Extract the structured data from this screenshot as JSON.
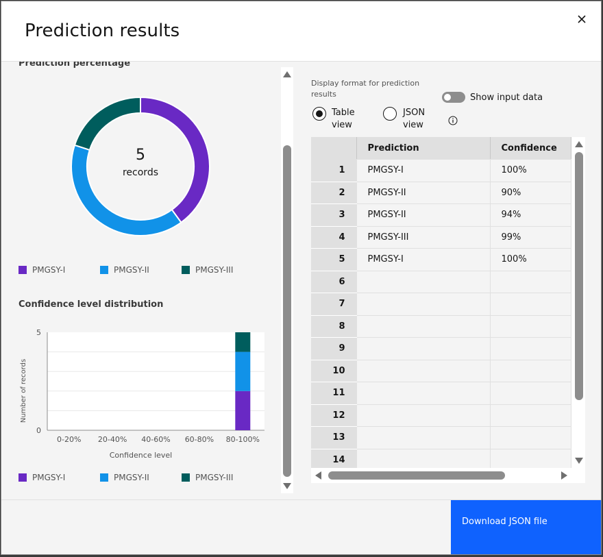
{
  "modal": {
    "title": "Prediction results",
    "close_icon": "close-icon"
  },
  "left": {
    "section_cut_heading": "Prediction percentage",
    "donut": {
      "count": "5",
      "label": "records",
      "slices": [
        {
          "name": "PMGSY-I",
          "value": 2,
          "color": "#6929c4"
        },
        {
          "name": "PMGSY-II",
          "value": 2,
          "color": "#1192e8"
        },
        {
          "name": "PMGSY-III",
          "value": 1,
          "color": "#005d5d"
        }
      ]
    },
    "legend": [
      {
        "label": "PMGSY-I",
        "color": "#6929c4"
      },
      {
        "label": "PMGSY-II",
        "color": "#1192e8"
      },
      {
        "label": "PMGSY-III",
        "color": "#005d5d"
      }
    ],
    "confidence_heading": "Confidence level distribution"
  },
  "chart_data": [
    {
      "type": "pie",
      "categories": [
        "PMGSY-I",
        "PMGSY-II",
        "PMGSY-III"
      ],
      "values": [
        2,
        2,
        1
      ],
      "center_text": "5 records"
    },
    {
      "type": "bar",
      "stacked": true,
      "categories": [
        "0-20%",
        "20-40%",
        "40-60%",
        "60-80%",
        "80-100%"
      ],
      "series": [
        {
          "name": "PMGSY-I",
          "color": "#6929c4",
          "values": [
            0,
            0,
            0,
            0,
            2
          ]
        },
        {
          "name": "PMGSY-II",
          "color": "#1192e8",
          "values": [
            0,
            0,
            0,
            0,
            2
          ]
        },
        {
          "name": "PMGSY-III",
          "color": "#005d5d",
          "values": [
            0,
            0,
            0,
            0,
            1
          ]
        }
      ],
      "xlabel": "Confidence level",
      "ylabel": "Number of records",
      "yticks": [
        "0",
        "5"
      ],
      "ylim": [
        0,
        5
      ],
      "legend_position": "bottom"
    }
  ],
  "right": {
    "display_format_label": "Display format for prediction results",
    "radio_table_label": "Table view",
    "radio_json_label": "JSON view",
    "toggle_label": "Show input data",
    "info_icon": "info-icon",
    "grid": {
      "headers": [
        "Prediction",
        "Confidence"
      ],
      "rows": [
        {
          "n": "1",
          "prediction": "PMGSY-I",
          "confidence": "100%"
        },
        {
          "n": "2",
          "prediction": "PMGSY-II",
          "confidence": "90%"
        },
        {
          "n": "3",
          "prediction": "PMGSY-II",
          "confidence": "94%"
        },
        {
          "n": "4",
          "prediction": "PMGSY-III",
          "confidence": "99%"
        },
        {
          "n": "5",
          "prediction": "PMGSY-I",
          "confidence": "100%"
        },
        {
          "n": "6",
          "prediction": "",
          "confidence": ""
        },
        {
          "n": "7",
          "prediction": "",
          "confidence": ""
        },
        {
          "n": "8",
          "prediction": "",
          "confidence": ""
        },
        {
          "n": "9",
          "prediction": "",
          "confidence": ""
        },
        {
          "n": "10",
          "prediction": "",
          "confidence": ""
        },
        {
          "n": "11",
          "prediction": "",
          "confidence": ""
        },
        {
          "n": "12",
          "prediction": "",
          "confidence": ""
        },
        {
          "n": "13",
          "prediction": "",
          "confidence": ""
        },
        {
          "n": "14",
          "prediction": "",
          "confidence": ""
        }
      ]
    }
  },
  "footer": {
    "download_label": "Download JSON file"
  }
}
